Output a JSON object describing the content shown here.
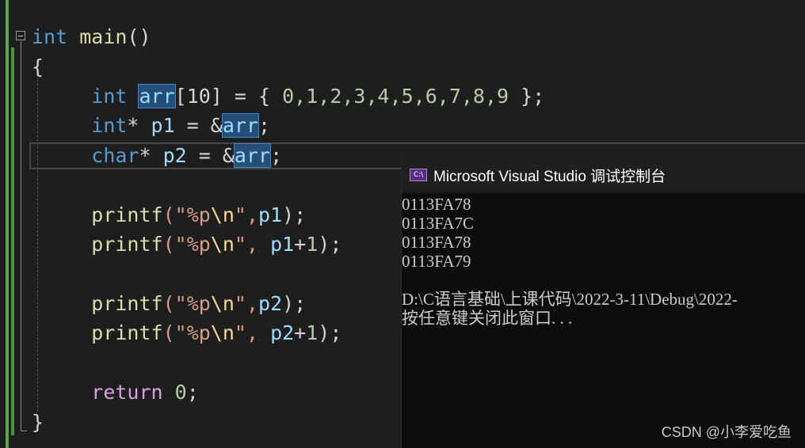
{
  "editor": {
    "lines": [
      {
        "kw": "int",
        "fn": "main",
        "rest": "()"
      },
      {
        "brace_open": "{"
      },
      {
        "kw": "int",
        "arr": "arr",
        "tail": "[10] = { ",
        "nums": "0,1,2,3,4,5,6,7,8,9",
        "end": " };"
      },
      {
        "kw": "int",
        "mid": "* ",
        "var": "p1",
        "eq": " = &",
        "arr": "arr",
        "end": ";"
      },
      {
        "kw": "char",
        "mid": "* ",
        "var": "p2",
        "eq": " = &",
        "arr": "arr",
        "end": ";"
      },
      {
        "fn": "printf",
        "open": "(\"",
        "fmt": "%p",
        "esc": "\\n",
        "close": "\",",
        "var": "p1",
        "end": ");"
      },
      {
        "fn": "printf",
        "open": "(\"",
        "fmt": "%p",
        "esc": "\\n",
        "close": "\", ",
        "var": "p1",
        "plus": "+",
        "num": "1",
        "end": ");"
      },
      {
        "fn": "printf",
        "open": "(\"",
        "fmt": "%p",
        "esc": "\\n",
        "close": "\",",
        "var": "p2",
        "end": ");"
      },
      {
        "fn": "printf",
        "open": "(\"",
        "fmt": "%p",
        "esc": "\\n",
        "close": "\", ",
        "var": "p2",
        "plus": "+",
        "num": "1",
        "end": ");"
      },
      {
        "kw": "return",
        "num": " 0",
        "end": ";"
      },
      {
        "brace_close": "}"
      }
    ]
  },
  "console": {
    "icon_text": "C:\\",
    "title": "Microsoft Visual Studio 调试控制台",
    "output": [
      "0113FA78",
      "0113FA7C",
      "0113FA78",
      "0113FA79",
      "",
      "D:\\C语言基础\\上课代码\\2022-3-11\\Debug\\2022-",
      "按任意键关闭此窗口. . ."
    ]
  },
  "watermark": "CSDN @小李爱吃鱼"
}
